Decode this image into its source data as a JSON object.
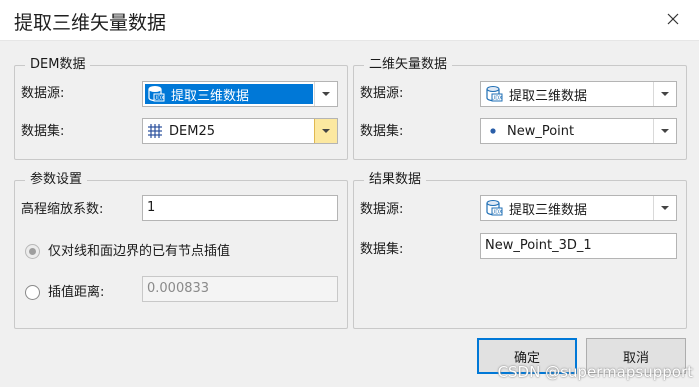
{
  "window": {
    "title": "提取三维矢量数据",
    "close_icon": "close-icon"
  },
  "dem_group": {
    "title": "DEM数据",
    "datasource_label": "数据源:",
    "datasource_value": "提取三维数据",
    "datasource_icon": "datasource-udx-icon",
    "dataset_label": "数据集:",
    "dataset_value": "DEM25",
    "dataset_icon": "grid-icon"
  },
  "vector_group": {
    "title": "二维矢量数据",
    "datasource_label": "数据源:",
    "datasource_value": "提取三维数据",
    "datasource_icon": "datasource-udx-icon",
    "dataset_label": "数据集:",
    "dataset_value": "New_Point",
    "dataset_icon": "point-icon"
  },
  "params_group": {
    "title": "参数设置",
    "scale_label": "高程缩放系数:",
    "scale_value": "1",
    "radio_existing_label": "仅对线和面边界的已有节点插值",
    "radio_distance_label": "插值距离:",
    "distance_value": "0.000833"
  },
  "result_group": {
    "title": "结果数据",
    "datasource_label": "数据源:",
    "datasource_value": "提取三维数据",
    "datasource_icon": "datasource-udx-icon",
    "dataset_label": "数据集:",
    "dataset_value": "New_Point_3D_1"
  },
  "buttons": {
    "ok_label": "确定",
    "cancel_label": "取消"
  },
  "watermark": "CSDN @supermapsupport",
  "colors": {
    "selection": "#0078d7",
    "dropdown_highlight": "#fce8a0",
    "udx_icon": "#1f6fb5"
  }
}
